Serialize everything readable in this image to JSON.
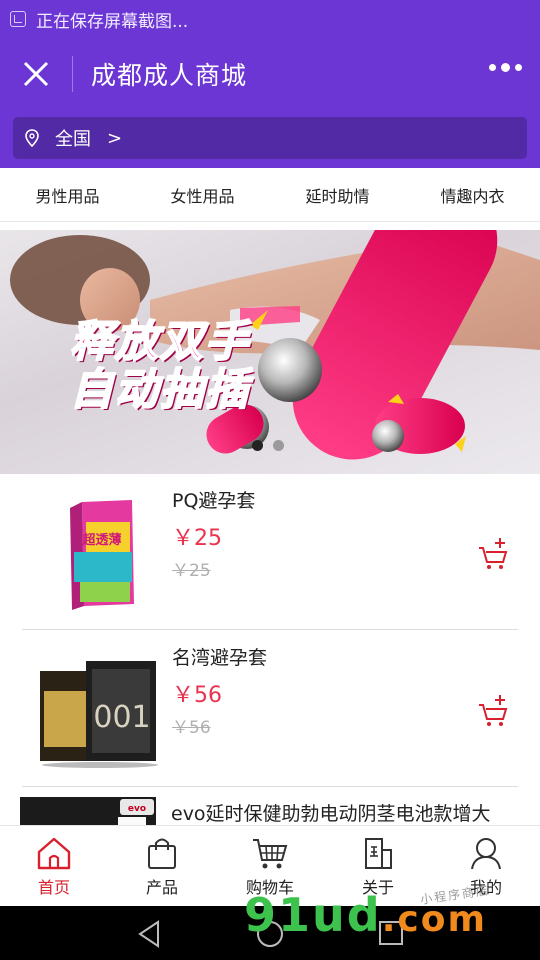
{
  "status_bar": {
    "text": "正在保存屏幕截图..."
  },
  "header": {
    "title": "成都成人商城"
  },
  "location": {
    "label": "全国",
    "arrow": ">"
  },
  "categories": [
    "男性用品",
    "女性用品",
    "延时助情",
    "情趣内衣"
  ],
  "banner": {
    "line1": "释放双手",
    "line2": "自动抽插",
    "slide_count": 2,
    "active_slide": 1
  },
  "products": [
    {
      "name": "PQ避孕套",
      "price": "￥25",
      "old_price": "￥25",
      "thumb_label": "超透薄"
    },
    {
      "name": "名湾避孕套",
      "price": "￥56",
      "old_price": "￥56",
      "thumb_label": "001"
    },
    {
      "name": "evo延时保健助勃电动阴茎电池款增大",
      "price": "",
      "old_price": "",
      "thumb_label": "evo"
    }
  ],
  "tabbar": {
    "items": [
      {
        "label": "首页",
        "icon": "home-icon",
        "active": true
      },
      {
        "label": "产品",
        "icon": "bag-icon",
        "active": false
      },
      {
        "label": "购物车",
        "icon": "cart-icon",
        "active": false
      },
      {
        "label": "关于",
        "icon": "building-icon",
        "active": false
      },
      {
        "label": "我的",
        "icon": "user-icon",
        "active": false
      }
    ]
  },
  "watermark": {
    "main": "91ud",
    "suffix": ".com",
    "sub": "小程序商店"
  },
  "colors": {
    "primary": "#6b36d4",
    "location_bg": "#532aa6",
    "price": "#e8344e",
    "active_tab": "#d8202e"
  }
}
